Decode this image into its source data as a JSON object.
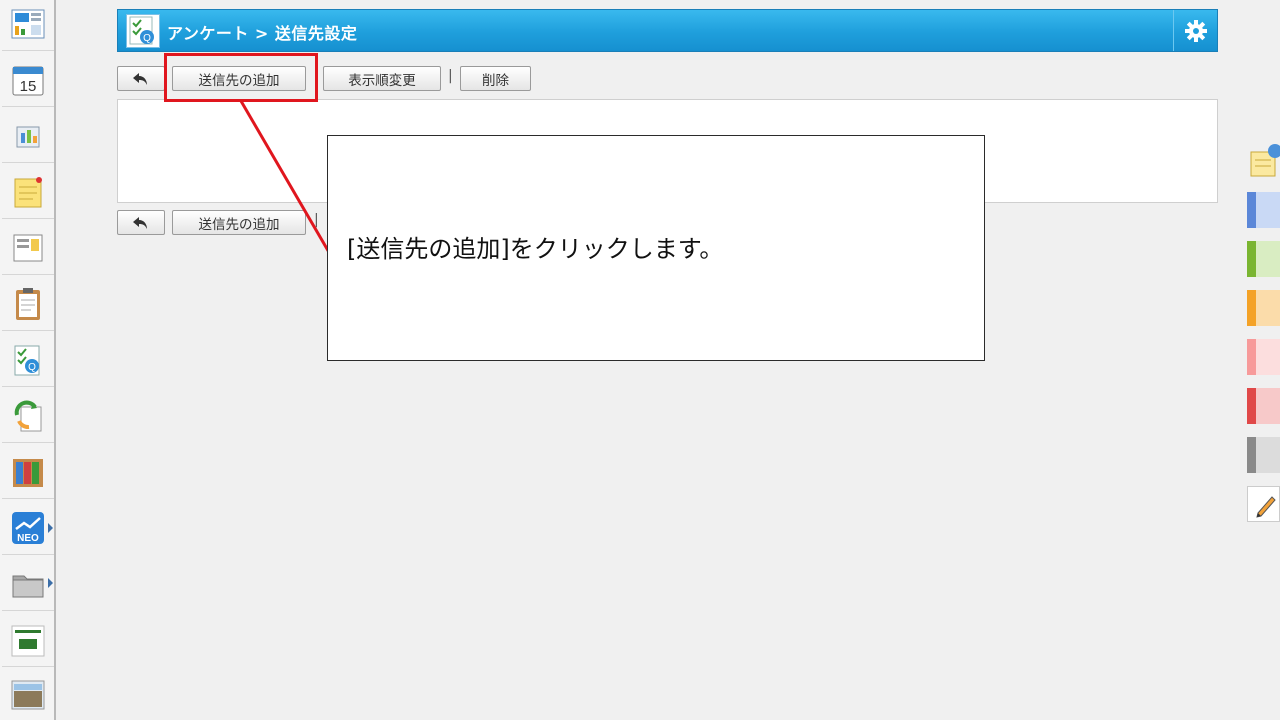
{
  "header": {
    "title": "アンケート > 送信先設定"
  },
  "toolbar": {
    "back_icon": "undo-arrow-icon",
    "add_recipient_label": "送信先の追加",
    "reorder_label": "表示順変更",
    "delete_label": "削除",
    "separator": "|"
  },
  "bottom_toolbar": {
    "add_recipient_label": "送信先の追加"
  },
  "callout": {
    "text": "[送信先の追加]をクリックします。"
  },
  "sidebar": {
    "apps": [
      {
        "icon": "portal-icon"
      },
      {
        "icon": "calendar-icon",
        "label": "15"
      },
      {
        "icon": "facility-icon"
      },
      {
        "icon": "memo-icon"
      },
      {
        "icon": "bulletin-board-icon"
      },
      {
        "icon": "clipboard-icon"
      },
      {
        "icon": "survey-icon"
      },
      {
        "icon": "workflow-icon"
      },
      {
        "icon": "cabinet-icon"
      },
      {
        "icon": "neo-icon",
        "label": "NEO"
      },
      {
        "icon": "folder-icon"
      },
      {
        "icon": "tanomeru-icon"
      },
      {
        "icon": "photo-app-icon"
      }
    ]
  },
  "palette": {
    "colors": [
      "#5b87d8",
      "#7ab531",
      "#f4a227",
      "#f79a9a",
      "#e04848",
      "#8a8a8a"
    ]
  },
  "colors": {
    "header_bg": "#1f9fdc",
    "highlight": "#e0161e"
  }
}
